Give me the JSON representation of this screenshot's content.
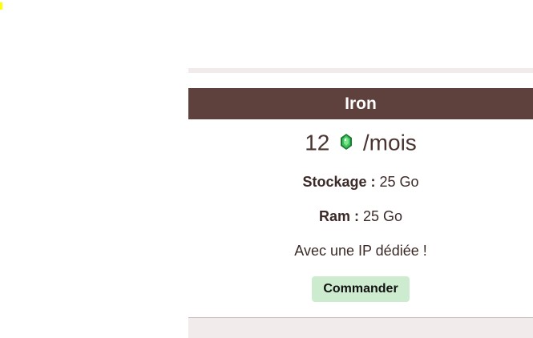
{
  "plan": {
    "name": "Iron",
    "price": "12",
    "period": "/mois",
    "currency_icon": "emerald-icon",
    "storage_label": "Stockage :",
    "storage_value": "25 Go",
    "ram_label": "Ram :",
    "ram_value": "25 Go",
    "ip_note": "Avec une IP dédiée !",
    "order_label": "Commander"
  },
  "colors": {
    "header_bg": "#5e403c",
    "button_bg": "#cdeccf",
    "band_bg": "#f2ebeb",
    "gem": "#2fa84a"
  }
}
